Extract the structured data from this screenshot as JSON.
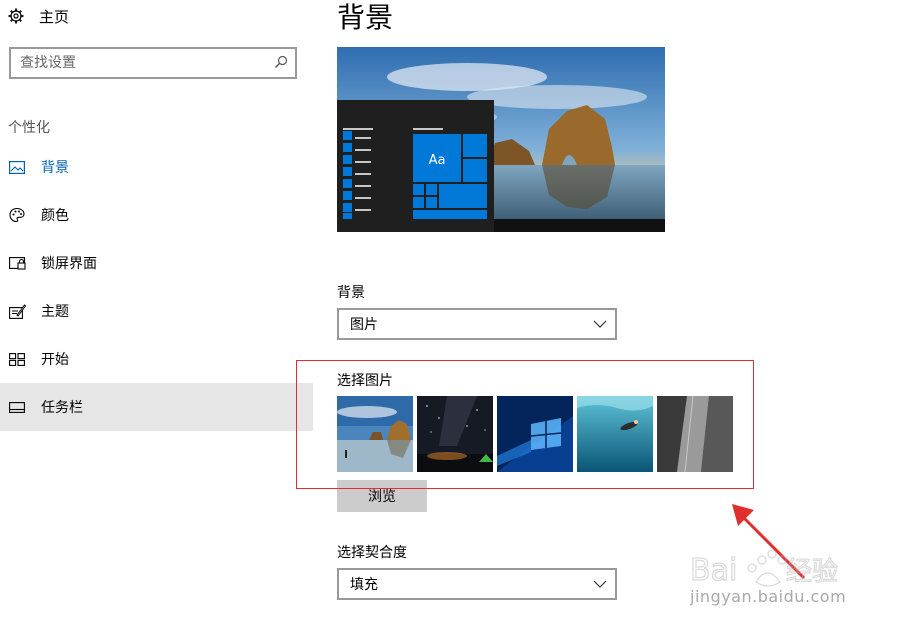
{
  "sidebar": {
    "home_label": "主页",
    "search": {
      "placeholder": "查找设置"
    },
    "section_title": "个性化",
    "items": [
      {
        "label": "背景",
        "icon": "picture-icon",
        "active": true
      },
      {
        "label": "颜色",
        "icon": "palette-icon"
      },
      {
        "label": "锁屏界面",
        "icon": "lock-screen-icon"
      },
      {
        "label": "主题",
        "icon": "theme-icon"
      },
      {
        "label": "开始",
        "icon": "start-icon"
      },
      {
        "label": "任务栏",
        "icon": "taskbar-icon",
        "hover": true
      }
    ]
  },
  "main": {
    "page_title": "背景",
    "preview_tile_text": "Aa",
    "background_label": "背景",
    "background_value": "图片",
    "choose_picture_label": "选择图片",
    "thumbnails": [
      "beach-rock-thumbnail",
      "night-sky-tent-thumbnail",
      "windows-logo-thumbnail",
      "underwater-swimmer-thumbnail",
      "rock-cliff-thumbnail"
    ],
    "browse_label": "浏览",
    "fit_label": "选择契合度",
    "fit_value": "填充"
  },
  "watermark": {
    "text": "jingyan.baidu.com"
  },
  "colors": {
    "accent": "#0063b1",
    "annotation": "#e0302e",
    "hover_bg": "#e6e6e6"
  }
}
